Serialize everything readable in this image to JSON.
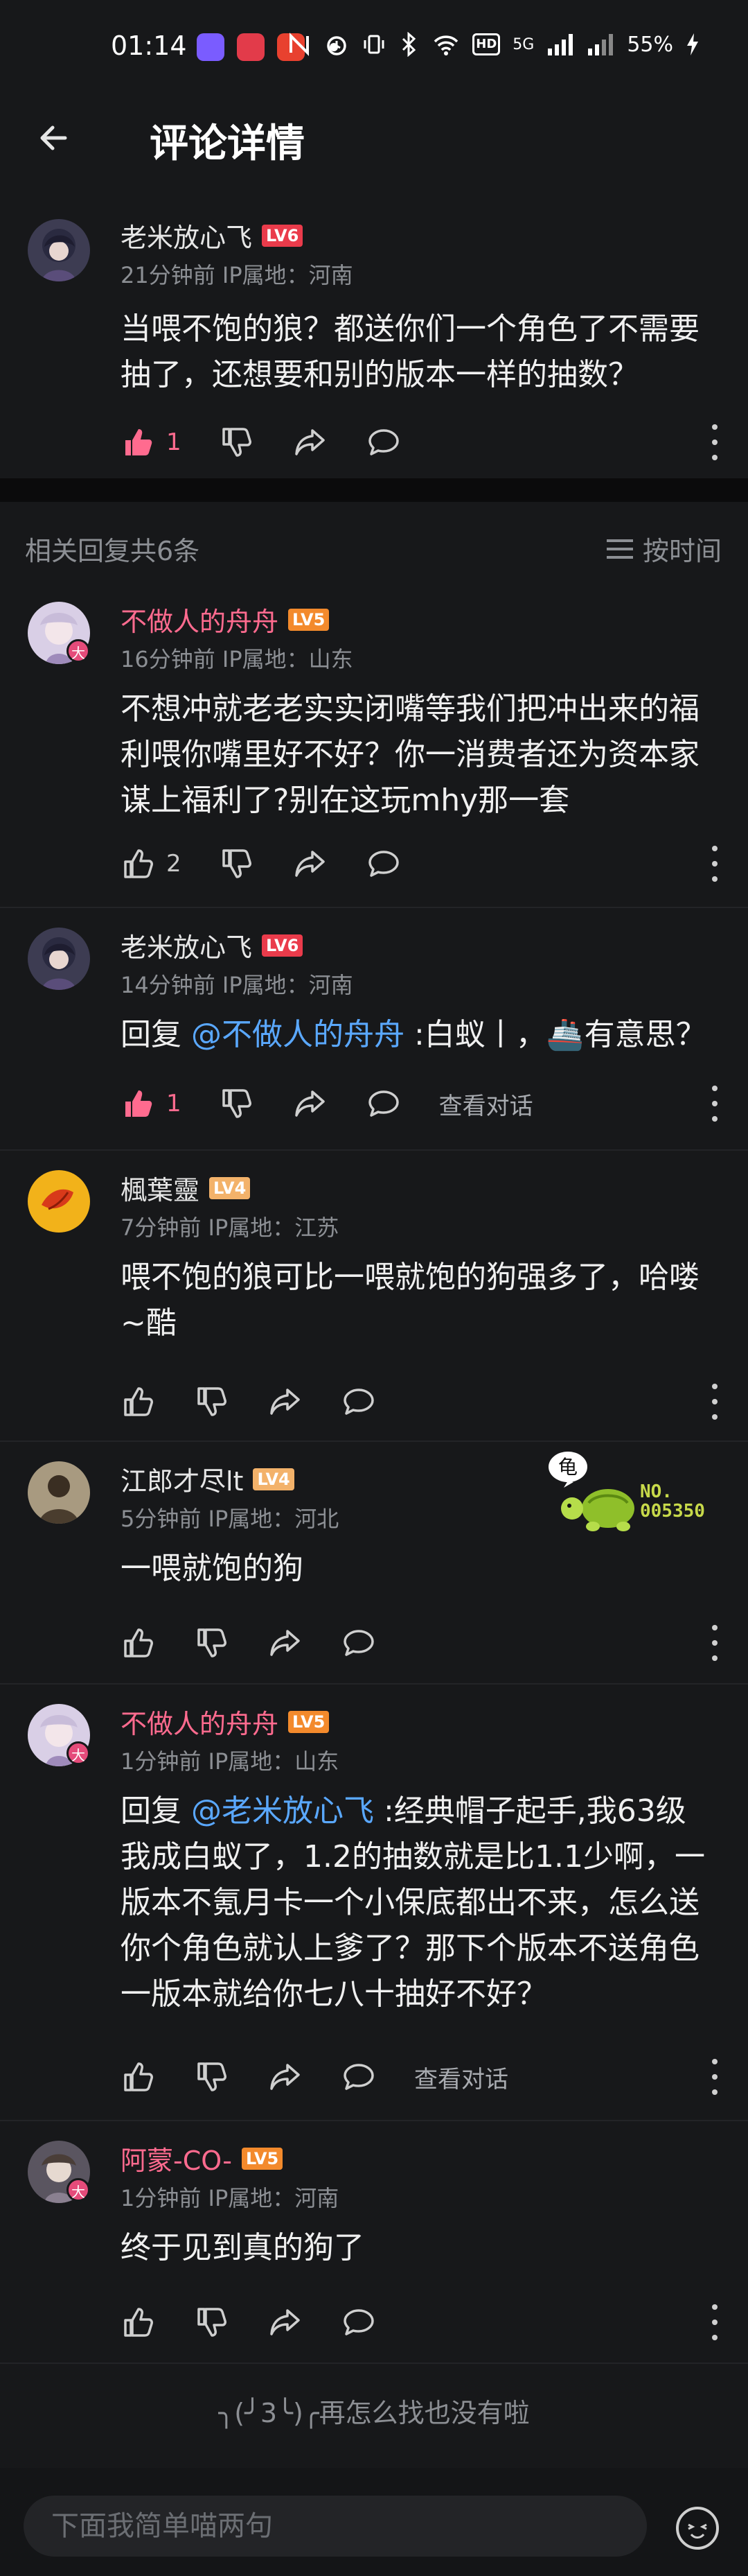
{
  "status_bar": {
    "time": "01:14",
    "battery": "55%",
    "net": "5G"
  },
  "header": {
    "title": "评论详情"
  },
  "main_comment": {
    "username": "老米放心飞",
    "level": "LV6",
    "meta": "21分钟前  IP属地：河南",
    "content": "当喂不饱的狼？都送你们一个角色了不需要抽了，还想要和别的版本一样的抽数？",
    "likes": "1"
  },
  "replies_header": {
    "count_label": "相关回复共6条",
    "sort_label": "按时间"
  },
  "replies": [
    {
      "username": "不做人的舟舟",
      "level": "LV5",
      "meta": "16分钟前  IP属地：山东",
      "content": "不想冲就老老实实闭嘴等我们把冲出来的福利喂你嘴里好不好？你一消费者还为资本家谋上福利了?别在这玩mhy那一套",
      "likes": "2",
      "badge": "大"
    },
    {
      "username": "老米放心飞",
      "level": "LV6",
      "meta": "14分钟前  IP属地：河南",
      "reply_prefix": "回复 ",
      "mention": "@不做人的舟舟",
      "content": " :白蚁丨，🚢有意思？",
      "likes": "1",
      "view_convo": "查看对话"
    },
    {
      "username": "楓葉靈",
      "level": "LV4",
      "meta": "7分钟前  IP属地：江苏",
      "content": "喂不饱的狼可比一喂就饱的狗强多了，哈喽~酷"
    },
    {
      "username": "江郎才尽lt",
      "level": "LV4",
      "meta": "5分钟前  IP属地：河北",
      "content": "一喂就饱的狗",
      "sticker_text": "龟",
      "sticker_no": "NO.\n005350"
    },
    {
      "username": "不做人的舟舟",
      "level": "LV5",
      "meta": "1分钟前  IP属地：山东",
      "reply_prefix": "回复 ",
      "mention": "@老米放心飞",
      "content": " :经典帽子起手,我63级我成白蚁了，1.2的抽数就是比1.1少啊，一版本不氪月卡一个小保底都出不来，怎么送你个角色就认上爹了？那下个版本不送角色一版本就给你七八十抽好不好？",
      "view_convo": "查看对话",
      "badge": "大"
    },
    {
      "username": "阿蒙-CO-",
      "level": "LV5",
      "meta": "1分钟前  IP属地：河南",
      "content": "终于见到真的狗了",
      "badge": "大"
    }
  ],
  "end_message": "╮(╯3╰)╭再怎么找也没有啦",
  "input": {
    "placeholder": "下面我简单喵两句"
  },
  "colors": {
    "background": "#17181a",
    "accent_pink": "#ff6b8f",
    "mention_blue": "#5aa8ff",
    "muted": "#8c8f94"
  }
}
